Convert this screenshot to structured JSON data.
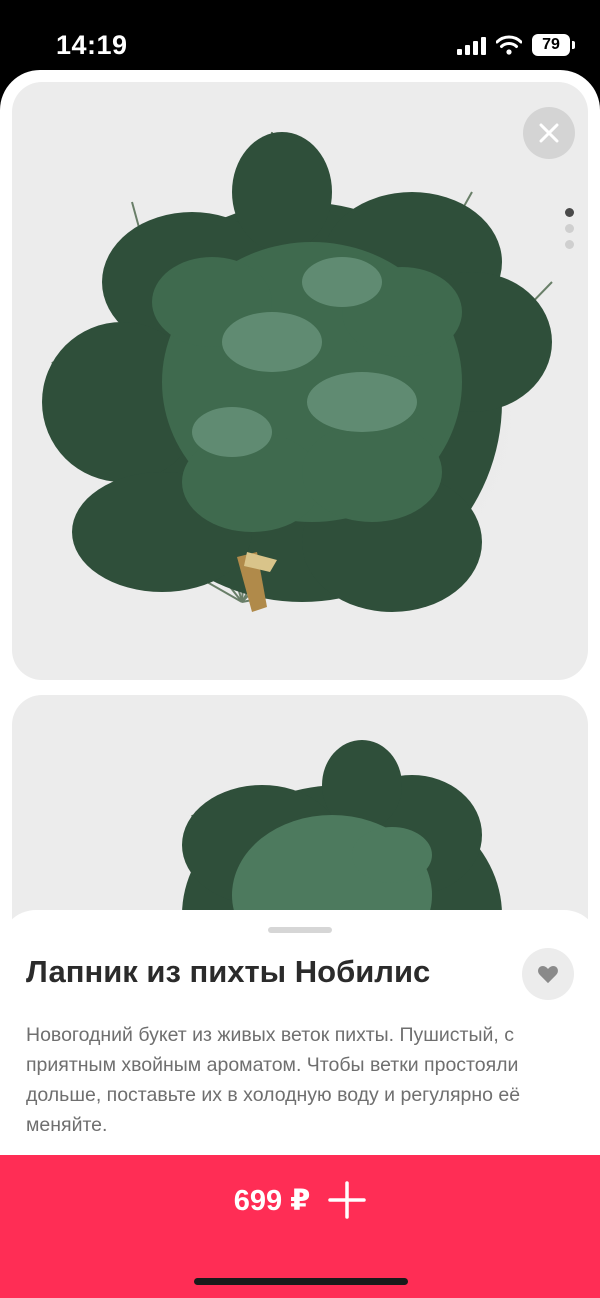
{
  "status_bar": {
    "time": "14:19",
    "battery_level": "79",
    "icons": [
      "cellular-signal-icon",
      "wifi-icon",
      "battery-icon"
    ]
  },
  "gallery": {
    "images": [
      "fir-branch-bouquet-photo-1",
      "fir-branch-bouquet-photo-2"
    ],
    "page_count": 3,
    "active_page": 1
  },
  "product": {
    "title": "Лапник из пихты Нобилис",
    "description": "Новогодний букет из живых веток пихты. Пушистый, с приятным хвойным ароматом. Чтобы ветки простояли дольше, поставьте их в холодную воду и регулярно её меняйте."
  },
  "buy_button": {
    "price": "699 ₽",
    "icon": "plus-icon"
  },
  "colors": {
    "accent": "#ff2d55",
    "card_background": "#ececec",
    "title": "#2b2b2b",
    "description": "#6f6f6f"
  }
}
